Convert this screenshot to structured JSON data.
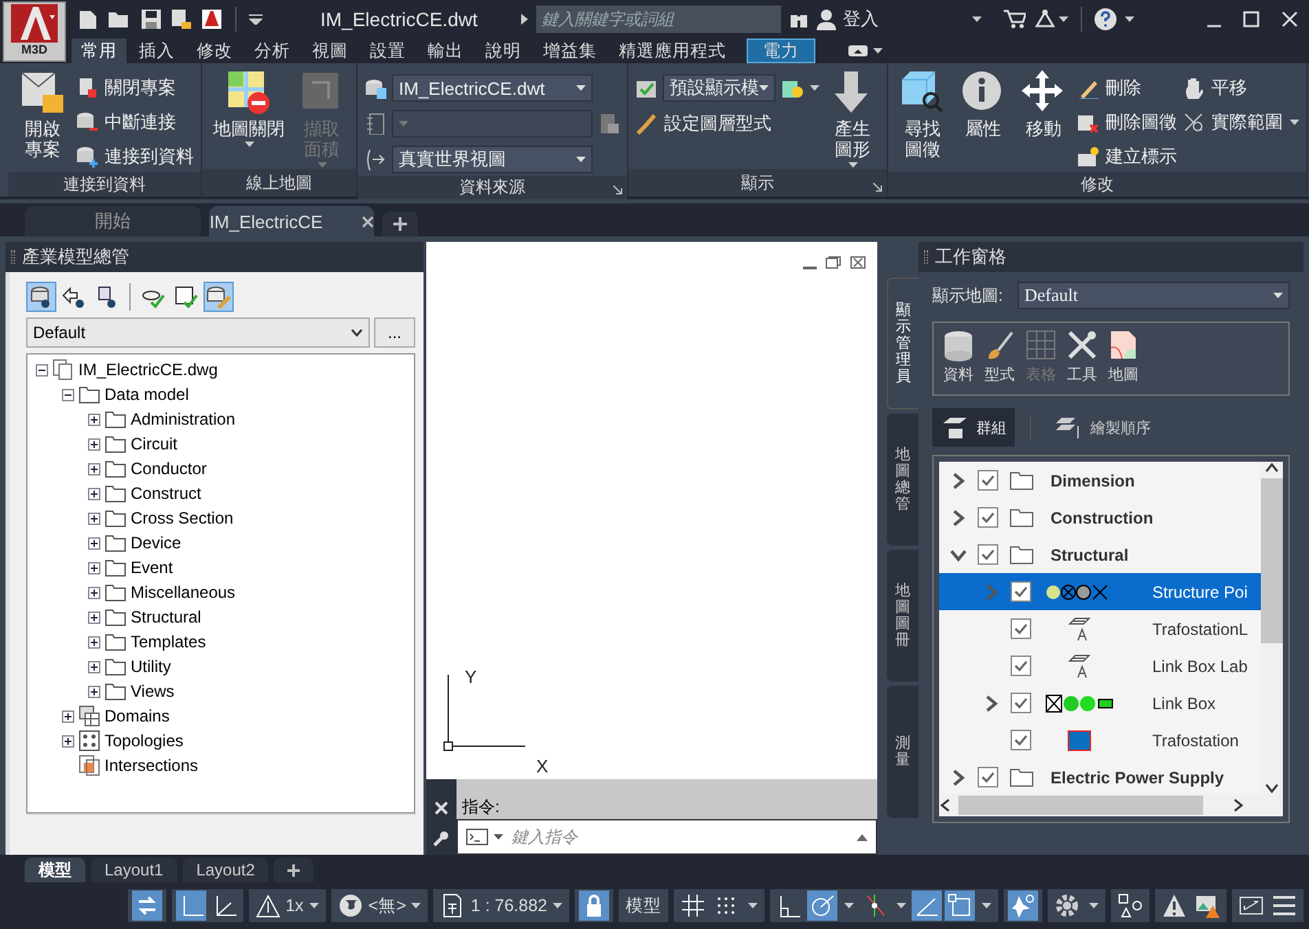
{
  "app_button": {
    "label": "M3D"
  },
  "title_bar": {
    "title": "IM_ElectricCE.dwt",
    "search": {
      "placeholder": "鍵入關鍵字或詞組"
    },
    "sign_in": "登入"
  },
  "ribbon_tabs": [
    {
      "label": "常用",
      "selected": true,
      "contextual": false
    },
    {
      "label": "插入",
      "selected": false,
      "contextual": false
    },
    {
      "label": "修改",
      "selected": false,
      "contextual": false
    },
    {
      "label": "分析",
      "selected": false,
      "contextual": false
    },
    {
      "label": "視圖",
      "selected": false,
      "contextual": false
    },
    {
      "label": "設置",
      "selected": false,
      "contextual": false
    },
    {
      "label": "輸出",
      "selected": false,
      "contextual": false
    },
    {
      "label": "說明",
      "selected": false,
      "contextual": false
    },
    {
      "label": "增益集",
      "selected": false,
      "contextual": false
    },
    {
      "label": "精選應用程式",
      "selected": false,
      "contextual": false
    },
    {
      "label": "電力",
      "selected": false,
      "contextual": true
    }
  ],
  "ribbon_panels": [
    {
      "title": "連接到資料",
      "columns": [
        [
          {
            "kind": "large",
            "label": "開啟專案",
            "caret": false,
            "disabled": false
          }
        ],
        [
          {
            "kind": "small",
            "label": "關閉專案",
            "caret": false,
            "disabled": false
          },
          {
            "kind": "small",
            "label": "中斷連接",
            "caret": false,
            "disabled": false
          },
          {
            "kind": "small",
            "label": "連接到資料",
            "caret": false,
            "disabled": false
          }
        ]
      ]
    },
    {
      "title": "線上地圖",
      "columns": [
        [
          {
            "kind": "large",
            "label": "地圖關閉",
            "caret": true,
            "disabled": false
          }
        ],
        [
          {
            "kind": "large",
            "label": "擷取面積",
            "caret": true,
            "disabled": true
          }
        ]
      ]
    },
    {
      "title": "資料來源",
      "launcher": true,
      "columns": [
        [
          {
            "kind": "combo",
            "value": "IM_ElectricCE.dwt",
            "side_button": false,
            "disabled": false
          },
          {
            "kind": "combo",
            "side_button": true,
            "disabled": true
          },
          {
            "kind": "combo",
            "value": "真實世界視圖",
            "side_button": false,
            "disabled": false
          }
        ]
      ]
    },
    {
      "title": "顯示",
      "launcher": true,
      "columns": [
        [
          {
            "kind": "combo",
            "value": "預設顯示模",
            "side_button": true,
            "disabled": false
          },
          {
            "kind": "small",
            "label": "設定圖層型式",
            "caret": false,
            "disabled": false
          }
        ],
        [
          {
            "kind": "large",
            "label": "產生圖形",
            "caret": true,
            "disabled": false
          }
        ]
      ]
    },
    {
      "title": "修改",
      "columns": [
        [
          {
            "kind": "large",
            "label": "尋找圖徵",
            "caret": false,
            "disabled": false
          }
        ],
        [
          {
            "kind": "large",
            "label": "屬性",
            "caret": false,
            "disabled": false
          }
        ],
        [
          {
            "kind": "large",
            "label": "移動",
            "caret": false,
            "disabled": false
          }
        ],
        [
          {
            "kind": "small",
            "label": "刪除",
            "caret": false,
            "disabled": false
          },
          {
            "kind": "small",
            "label": "刪除圖徵",
            "caret": false,
            "disabled": false
          },
          {
            "kind": "small",
            "label": "建立標示",
            "caret": false,
            "disabled": false
          }
        ],
        [
          {
            "kind": "small",
            "label": "平移",
            "caret": false,
            "disabled": false
          },
          {
            "kind": "small",
            "label": "實際範圍",
            "caret": true,
            "disabled": false
          }
        ]
      ]
    }
  ],
  "document_tabs": [
    {
      "label": "開始",
      "selected": false
    },
    {
      "label": "IM_ElectricCE",
      "selected": true
    }
  ],
  "industry_model_explorer": {
    "title": "產業模型總管",
    "toolbar": [
      {
        "selected": true
      },
      {
        "selected": false
      },
      {
        "selected": false
      },
      {
        "selected": false
      },
      {
        "selected": false
      },
      {
        "selected": true
      }
    ],
    "dropdown": "Default",
    "more_button": "...",
    "tree": [
      {
        "label": "IM_ElectricCE.dwg",
        "kind": "file",
        "expanded": true,
        "children": [
          {
            "label": "Data model",
            "kind": "folder",
            "expanded": true,
            "children": [
              {
                "label": "Administration",
                "kind": "folder",
                "expanded": false
              },
              {
                "label": "Circuit",
                "kind": "folder",
                "expanded": false
              },
              {
                "label": "Conductor",
                "kind": "folder",
                "expanded": false
              },
              {
                "label": "Construct",
                "kind": "folder",
                "expanded": false
              },
              {
                "label": "Cross Section",
                "kind": "folder",
                "expanded": false
              },
              {
                "label": "Device",
                "kind": "folder",
                "expanded": false
              },
              {
                "label": "Event",
                "kind": "folder",
                "expanded": false
              },
              {
                "label": "Miscellaneous",
                "kind": "folder",
                "expanded": false
              },
              {
                "label": "Structural",
                "kind": "folder",
                "expanded": false
              },
              {
                "label": "Templates",
                "kind": "folder",
                "expanded": false
              },
              {
                "label": "Utility",
                "kind": "folder",
                "expanded": false
              },
              {
                "label": "Views",
                "kind": "folder",
                "expanded": false
              }
            ]
          },
          {
            "label": "Domains",
            "kind": "domains",
            "expanded": false
          },
          {
            "label": "Topologies",
            "kind": "topologies",
            "expanded": false
          },
          {
            "label": "Intersections",
            "kind": "intersections"
          }
        ]
      }
    ]
  },
  "drawing_area": {
    "ucs": {
      "x_label": "X",
      "y_label": "Y"
    }
  },
  "command_line": {
    "prompt": "指令:",
    "placeholder": "鍵入指令"
  },
  "task_pane": {
    "title": "工作窗格",
    "side_tabs": [
      {
        "label": "顯示管理員",
        "selected": true
      },
      {
        "label": "地圖總管",
        "selected": false
      },
      {
        "label": "地圖圖冊",
        "selected": false
      },
      {
        "label": "測量",
        "selected": false
      }
    ],
    "display_map_label": "顯示地圖:",
    "display_map": "Default",
    "tools": [
      {
        "label": "資料",
        "disabled": false
      },
      {
        "label": "型式",
        "disabled": false
      },
      {
        "label": "表格",
        "disabled": true
      },
      {
        "label": "工具",
        "disabled": false
      },
      {
        "label": "地圖",
        "disabled": false
      }
    ],
    "view_toggle": [
      {
        "label": "群組",
        "selected": true
      },
      {
        "label": "繪製順序",
        "selected": false
      }
    ],
    "layers": [
      {
        "name": "Dimension",
        "kind": "group",
        "checked": true,
        "expanded": false,
        "selected": false
      },
      {
        "name": "Construction",
        "kind": "group",
        "checked": true,
        "expanded": false,
        "selected": false
      },
      {
        "name": "Structural",
        "kind": "group",
        "checked": true,
        "expanded": true,
        "selected": false,
        "children": [
          {
            "name": "Structure Poi",
            "kind": "points",
            "checked": true,
            "expanded": false,
            "selected": true
          },
          {
            "name": "TrafostationL",
            "kind": "label",
            "checked": true,
            "selected": false
          },
          {
            "name": "Link Box Lab",
            "kind": "label",
            "checked": true,
            "selected": false
          },
          {
            "name": "Link Box",
            "kind": "linkbox",
            "checked": true,
            "expanded": false,
            "selected": false
          },
          {
            "name": "Trafostation",
            "kind": "area",
            "checked": true,
            "selected": false
          }
        ]
      },
      {
        "name": "Electric Power Supply",
        "kind": "group",
        "checked": true,
        "expanded": false,
        "selected": false
      }
    ]
  },
  "layout_tabs": [
    {
      "label": "模型",
      "selected": true
    },
    {
      "label": "Layout1",
      "selected": false
    },
    {
      "label": "Layout2",
      "selected": false
    }
  ],
  "status_bar": [
    {
      "items": [
        {
          "kind": "toggle",
          "on": true
        }
      ]
    },
    {
      "items": [
        {
          "kind": "toggle",
          "on": true
        },
        {
          "kind": "toggle",
          "on": false
        }
      ]
    },
    {
      "items": [
        {
          "kind": "value",
          "label": "1x"
        }
      ]
    },
    {
      "items": [
        {
          "kind": "value",
          "label": "<無>"
        }
      ]
    },
    {
      "items": [
        {
          "kind": "value",
          "label": "1 : 76.882"
        }
      ]
    },
    {
      "items": [
        {
          "kind": "toggle",
          "on": true
        }
      ]
    },
    {
      "items": [
        {
          "kind": "text",
          "label": "模型"
        }
      ]
    },
    {
      "items": [
        {
          "kind": "toggle",
          "on": false
        },
        {
          "kind": "toggle",
          "on": false
        },
        {
          "kind": "caret"
        }
      ]
    },
    {
      "items": [
        {
          "kind": "toggle",
          "on": false
        },
        {
          "kind": "toggle",
          "on": true
        },
        {
          "kind": "caret"
        },
        {
          "kind": "toggle",
          "on": false
        },
        {
          "kind": "caret"
        },
        {
          "kind": "toggle",
          "on": true
        },
        {
          "kind": "toggle",
          "on": true
        },
        {
          "kind": "caret"
        }
      ]
    },
    {
      "items": [
        {
          "kind": "toggle",
          "on": true
        }
      ]
    },
    {
      "items": [
        {
          "kind": "toggle",
          "on": false
        },
        {
          "kind": "caret"
        }
      ]
    },
    {
      "items": [
        {
          "kind": "toggle",
          "on": false
        }
      ]
    },
    {
      "items": [
        {
          "kind": "toggle",
          "on": false
        },
        {
          "kind": "toggle",
          "on": false
        }
      ]
    },
    {
      "items": [
        {
          "kind": "toggle",
          "on": false
        },
        {
          "kind": "toggle",
          "on": false
        }
      ]
    }
  ]
}
